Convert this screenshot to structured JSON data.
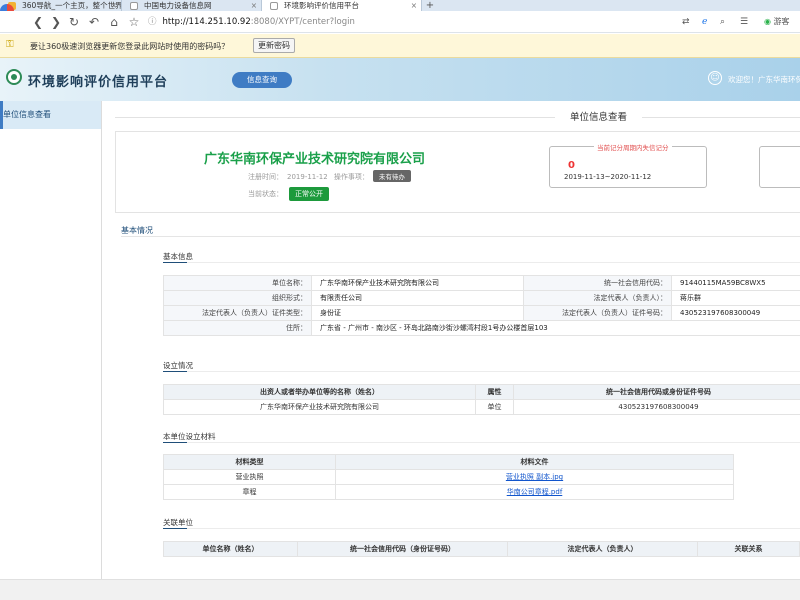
{
  "browser": {
    "tabs": [
      {
        "title": "360导航_一个主页，整个世界",
        "close": "×"
      },
      {
        "title": "中国电力设备信息网",
        "close": "×"
      },
      {
        "title": "环境影响评价信用平台",
        "close": "×"
      }
    ],
    "new_tab": "+",
    "nav": {
      "back": "❮",
      "forward": "❯",
      "reload": "↻",
      "undo": "↶",
      "home": "⌂",
      "star": "☆"
    },
    "url_host": "http://114.251.10.92",
    "url_rest": ":8080/XYPT/center?login",
    "right_user": "游客",
    "password_bar": {
      "message": "要让360极速浏览器更新您登录此网站时使用的密码吗？",
      "update_button": "更新密码"
    }
  },
  "header": {
    "title": "环境影响评价信用平台",
    "nav_button": "信息查询",
    "welcome": "欢迎您！广东华南环保产"
  },
  "sidebar": {
    "items": [
      {
        "label": "单位信息查看"
      }
    ]
  },
  "page": {
    "title": "单位信息查看"
  },
  "company_card": {
    "name": "广东华南环保产业技术研究院有限公司",
    "register_label": "注册时间：",
    "register_date": "2019-11-12",
    "op_label": "操作事项：",
    "op_badge": "未有待办",
    "status_label": "当前状态：",
    "status_badge": "正常公开",
    "score_legend": "当前记分周期内失信记分",
    "score_value": "0",
    "score_period": "2019-11-13~2020-11-12"
  },
  "section_title": "基本情况",
  "basic_info": {
    "title": "基本信息",
    "rows": [
      {
        "l1": "单位名称：",
        "v1": "广东华南环保产业技术研究院有限公司",
        "l2": "统一社会信用代码：",
        "v2": "91440115MA59BC8WX5"
      },
      {
        "l1": "组织形式：",
        "v1": "有限责任公司",
        "l2": "法定代表人（负责人）：",
        "v2": "蒋乐群"
      },
      {
        "l1": "法定代表人（负责人）证件类型：",
        "v1": "身份证",
        "l2": "法定代表人（负责人）证件号码：",
        "v2": "430523197608300049"
      }
    ],
    "address_label": "住所：",
    "address_value": "广东省 - 广州市 - 南沙区 - 环岛北路南沙街沙螺湾村段1号办公楼首层103"
  },
  "establishment": {
    "title": "设立情况",
    "headers": [
      "出资人或者举办单位等的名称（姓名）",
      "属性",
      "统一社会信用代码或身份证件号码"
    ],
    "rows": [
      [
        "广东华南环保产业技术研究院有限公司",
        "单位",
        "430523197608300049"
      ]
    ]
  },
  "materials": {
    "title": "本单位设立材料",
    "headers": [
      "材料类型",
      "材料文件"
    ],
    "rows": [
      [
        "营业执照",
        "营业执照 副本.jpg"
      ],
      [
        "章程",
        "华南公司章程.pdf"
      ]
    ]
  },
  "related": {
    "title": "关联单位",
    "headers": [
      "单位名称（姓名）",
      "统一社会信用代码（身份证号码）",
      "法定代表人（负责人）",
      "关联关系"
    ]
  }
}
